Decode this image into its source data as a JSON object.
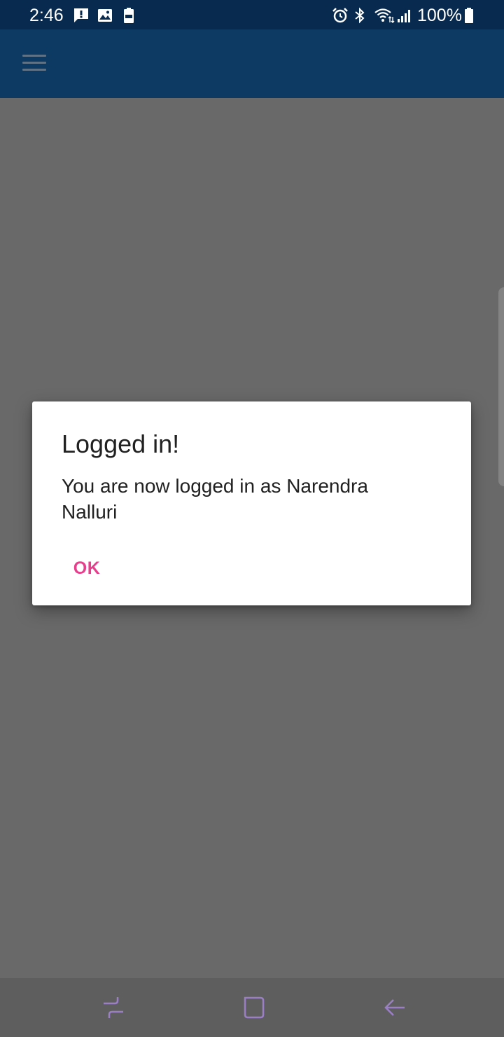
{
  "status_bar": {
    "time": "2:46",
    "battery_percent": "100%",
    "notification_icons": [
      "alert-message-icon",
      "image-icon",
      "battery-saver-icon"
    ],
    "system_icons": [
      "alarm-icon",
      "bluetooth-icon",
      "wifi-icon",
      "signal-icon",
      "battery-icon"
    ]
  },
  "app_bar": {
    "menu_icon": "hamburger-menu-icon",
    "color": "#0c3a63"
  },
  "dialog": {
    "title": "Logged in!",
    "message": "You are now logged in as Narendra Nalluri",
    "ok_label": "OK",
    "accent_color": "#e83f8c"
  },
  "nav_bar": {
    "icons": [
      "recent-apps-icon",
      "home-icon",
      "back-icon"
    ],
    "icon_color": "#9b7fc4"
  }
}
